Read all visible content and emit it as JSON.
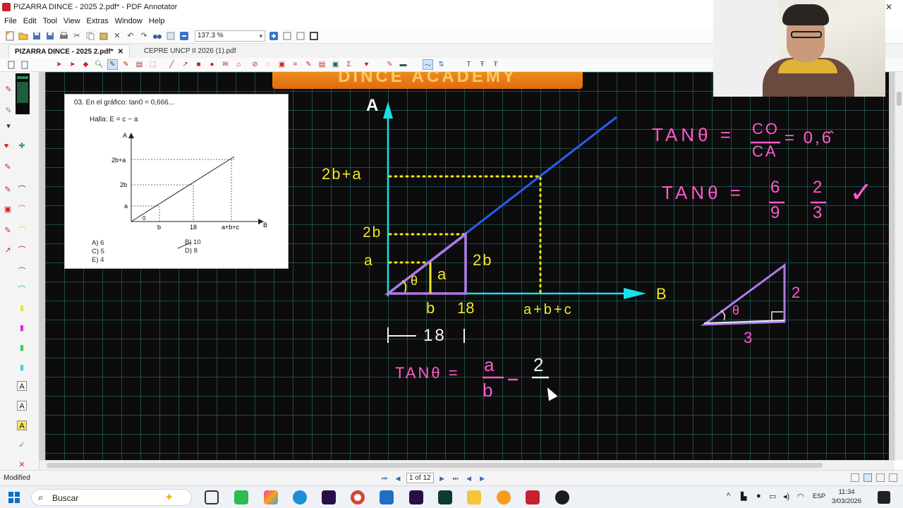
{
  "window": {
    "title": "PIZARRA DINCE - 2025 2.pdf* - PDF Annotator",
    "close_glyph": "✕"
  },
  "menu": [
    "File",
    "Edit",
    "Tool",
    "View",
    "Extras",
    "Window",
    "Help"
  ],
  "toolbar": {
    "zoom_value": "137.3 %"
  },
  "tabs": [
    {
      "label": "PIZARRA DINCE - 2025 2.pdf*",
      "active": true,
      "close": "✕"
    },
    {
      "label": "CEPRE UNCP II 2026 (1).pdf",
      "active": false
    }
  ],
  "board": {
    "banner_text": "DINCE ACADEMY"
  },
  "problem": {
    "number_line": "03.  En el gráfico: tan0 = 0,666...",
    "find_line": "Halla: E = c − a",
    "axis_labels": [
      "A",
      "B",
      "0",
      "2b+a",
      "2b",
      "a",
      "b",
      "18",
      "a+b+c"
    ],
    "options": [
      "A) 6",
      "C) 5",
      "E) 4",
      "B) 10",
      "D)  8"
    ]
  },
  "handwriting": {
    "axis_A": "A",
    "axis_B": "B",
    "label_2b_a": "2b+a",
    "label_2b": "2b",
    "label_a": "a",
    "tri_side_a": "a",
    "tri_side_2b": "2b",
    "tri_theta": "θ",
    "label_b": "b",
    "label_18": "18",
    "label_abc": "a+b+c",
    "measure_18": "18",
    "eq1_lhs": "TANθ =",
    "eq1_num": "a",
    "eq1_den": "b",
    "eq1_eq": "=",
    "eq1_rhs_num": "2",
    "tan_def_lhs": "TANθ =",
    "tan_def_num": "CO",
    "tan_def_den": "CA",
    "tan_def_rhs": "= 0,6̂",
    "tan_frac_lhs": "TANθ =",
    "tan_frac_num": "6",
    "tan_frac_den": "9",
    "tan_frac_rhs_num": "2",
    "tan_frac_rhs_den": "3",
    "check": "✓",
    "small_tri_2": "2",
    "small_tri_3": "3",
    "small_tri_theta": "θ"
  },
  "colors": {
    "board_bg": "#0c0c0c",
    "grid": "#3cbeb4",
    "axis_cyan": "#18e0e8",
    "line_blue": "#2a5cf0",
    "dotted_yellow": "#f5e60a",
    "handwriting_yellow": "#f2e62a",
    "triangle_violet": "#b07ae8",
    "pink": "#ff5acb",
    "banner_orange": "#f08a1c"
  },
  "status": {
    "left": "Modified",
    "page": "1 of 12"
  },
  "taskbar": {
    "search_placeholder": "Buscar",
    "lang": "ESP",
    "time": "11:34",
    "date": "3/03/2026"
  }
}
